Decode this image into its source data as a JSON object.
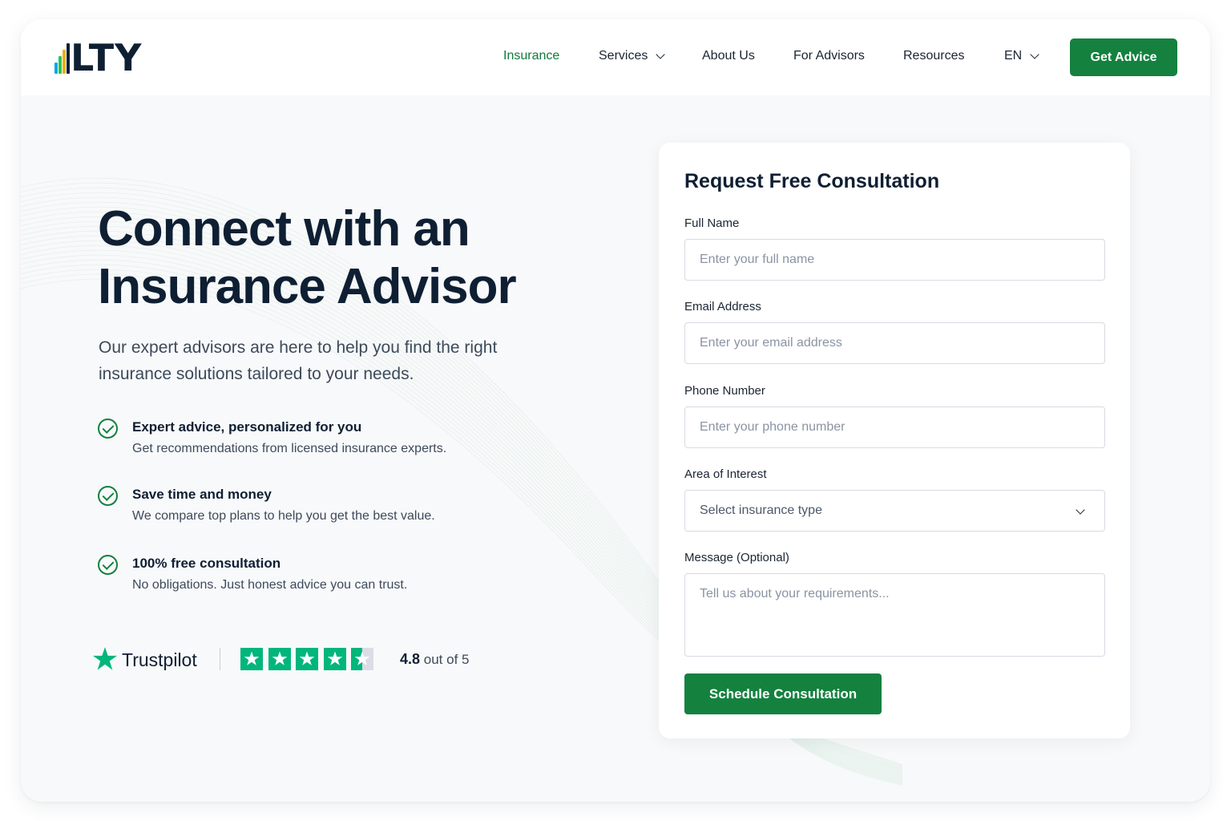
{
  "brand": {
    "logo_text": "LTY",
    "accent": "#14813f",
    "logo_bar_colors": [
      "#0ea5e9",
      "#22c55e",
      "#eab308",
      "#0f1f33"
    ]
  },
  "nav": {
    "items": [
      {
        "label": "Insurance",
        "active": true,
        "dropdown": false
      },
      {
        "label": "Services",
        "active": false,
        "dropdown": true
      },
      {
        "label": "About Us",
        "active": false,
        "dropdown": false
      },
      {
        "label": "For Advisors",
        "active": false,
        "dropdown": false
      },
      {
        "label": "Resources",
        "active": false,
        "dropdown": false
      },
      {
        "label": "EN",
        "active": false,
        "dropdown": true
      }
    ],
    "cta_label": "Get Advice"
  },
  "hero": {
    "title_line1": "Connect with an",
    "title_line2": "Insurance Advisor",
    "subtitle_line1": "Our expert advisors are here to help you find the right",
    "subtitle_line2": "insurance solutions tailored to your needs.",
    "features": [
      {
        "title": "Expert advice, personalized for you",
        "description": "Get recommendations from licensed insurance experts."
      },
      {
        "title": "Save time and money",
        "description": "We compare top plans to help you get the best value."
      },
      {
        "title": "100% free consultation",
        "description": "No obligations. Just honest advice you can trust."
      }
    ]
  },
  "trustpilot": {
    "name": "Trustpilot",
    "rating": "4.8",
    "rating_suffix": "out of 5",
    "stars_filled": 4.5,
    "star_color": "#00b67a",
    "empty_color": "#dcdce6"
  },
  "form": {
    "title": "Request Free Consultation",
    "fields": {
      "full_name": {
        "label": "Full Name",
        "placeholder": "Enter your full name",
        "value": ""
      },
      "email": {
        "label": "Email Address",
        "placeholder": "Enter your email address",
        "value": ""
      },
      "phone": {
        "label": "Phone Number",
        "placeholder": "Enter your phone number",
        "value": ""
      },
      "interest": {
        "label": "Area of Interest",
        "selected": "Select insurance type"
      },
      "message": {
        "label": "Message (Optional)",
        "placeholder": "Tell us about your requirements...",
        "value": ""
      }
    },
    "submit_label": "Schedule Consultation"
  }
}
